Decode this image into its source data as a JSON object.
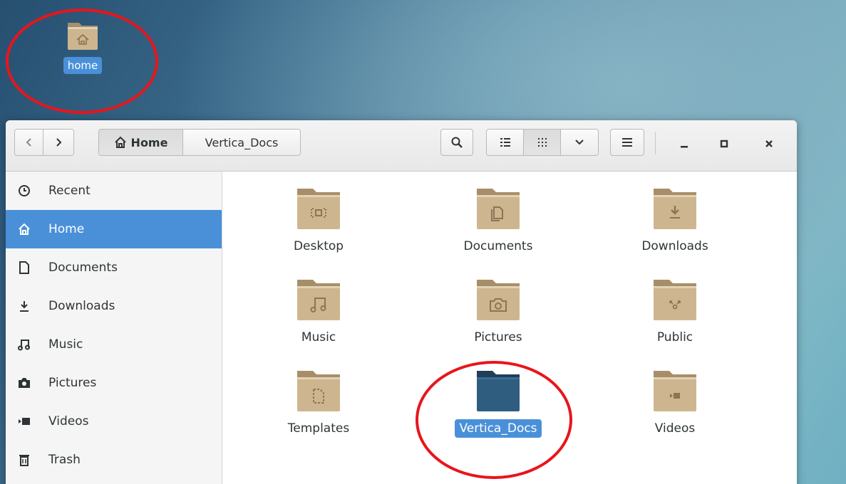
{
  "desktop": {
    "home_icon_name": "home-folder-icon",
    "home_label": "home"
  },
  "headerbar": {
    "back_icon": "chevron-left-icon",
    "forward_icon": "chevron-right-icon",
    "breadcrumb_home": "Home",
    "breadcrumb_current": "Vertica_Docs",
    "search_icon": "search-icon",
    "list_view_icon": "list-view-icon",
    "grid_view_icon": "grid-view-icon",
    "view_options_icon": "chevron-down-icon",
    "menu_icon": "hamburger-menu-icon",
    "minimize_icon": "minimize-icon",
    "maximize_icon": "maximize-icon",
    "close_icon": "close-icon"
  },
  "sidebar": {
    "items": [
      {
        "label": "Recent",
        "icon": "clock-icon"
      },
      {
        "label": "Home",
        "icon": "home-icon",
        "active": true
      },
      {
        "label": "Documents",
        "icon": "document-icon"
      },
      {
        "label": "Downloads",
        "icon": "download-icon"
      },
      {
        "label": "Music",
        "icon": "music-icon"
      },
      {
        "label": "Pictures",
        "icon": "camera-icon"
      },
      {
        "label": "Videos",
        "icon": "video-icon"
      },
      {
        "label": "Trash",
        "icon": "trash-icon"
      }
    ]
  },
  "files": [
    {
      "label": "Desktop",
      "icon": "desktop-folder-icon"
    },
    {
      "label": "Documents",
      "icon": "documents-folder-icon"
    },
    {
      "label": "Downloads",
      "icon": "downloads-folder-icon"
    },
    {
      "label": "Music",
      "icon": "music-folder-icon"
    },
    {
      "label": "Pictures",
      "icon": "pictures-folder-icon"
    },
    {
      "label": "Public",
      "icon": "public-folder-icon"
    },
    {
      "label": "Templates",
      "icon": "templates-folder-icon"
    },
    {
      "label": "Vertica_Docs",
      "icon": "folder-icon",
      "selected": true
    },
    {
      "label": "Videos",
      "icon": "videos-folder-icon"
    }
  ],
  "colors": {
    "accent": "#4a90d9",
    "folder_tan": "#c9b18a",
    "folder_selected": "#2f5d80",
    "annotation_red": "#e8151b"
  }
}
